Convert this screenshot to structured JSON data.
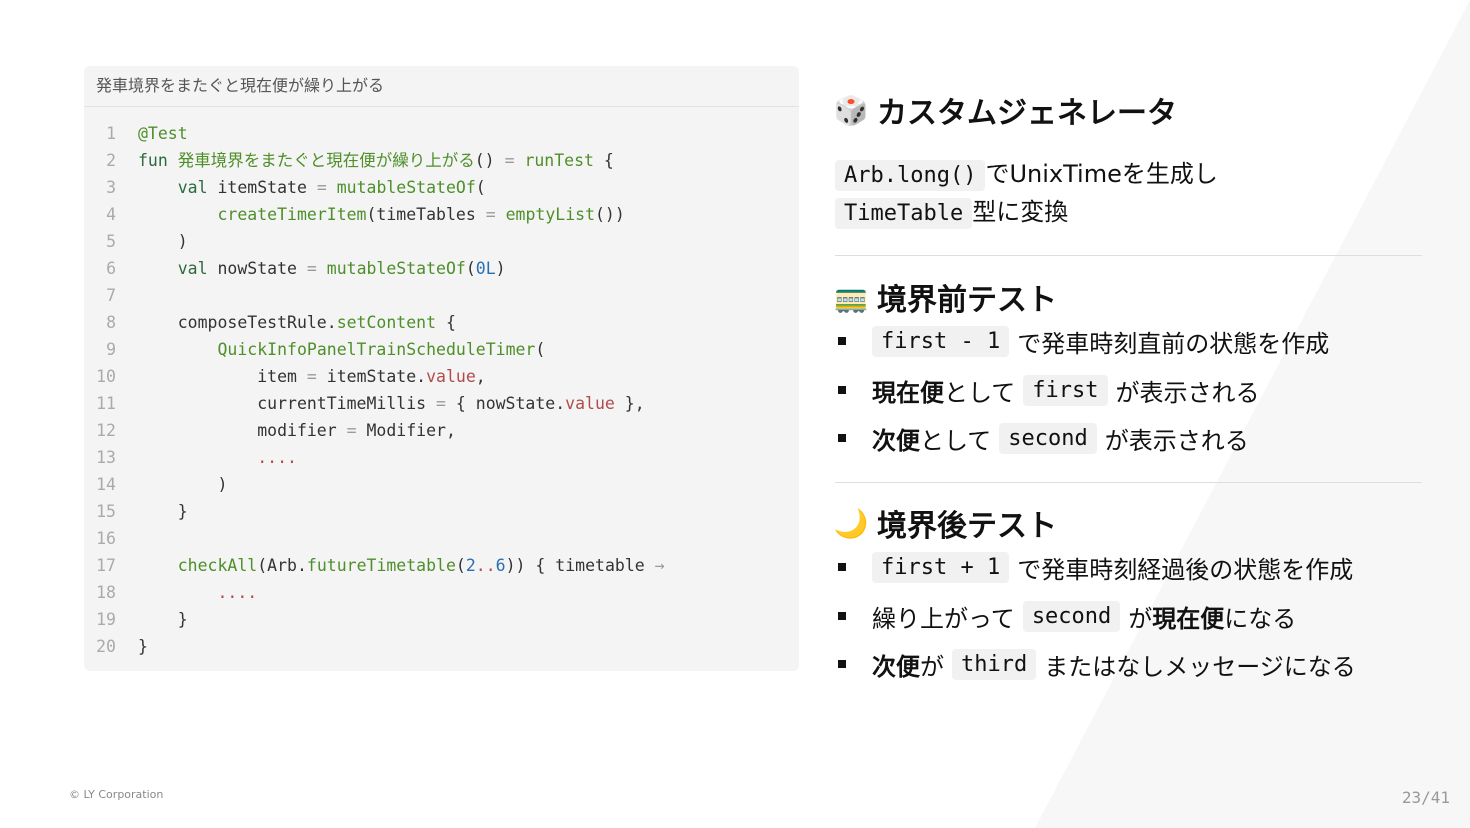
{
  "code_block": {
    "title": "発車境界をまたぐと現在便が繰り上がる",
    "lines": [
      {
        "num": "1",
        "tokens": [
          {
            "text": "@Test",
            "cls": "f"
          }
        ]
      },
      {
        "num": "2",
        "tokens": [
          {
            "text": "fun ",
            "cls": "k"
          },
          {
            "text": "発車境界をまたぐと現在便が繰り上がる",
            "cls": "f"
          },
          {
            "text": "() ",
            "cls": "t"
          },
          {
            "text": "=",
            "cls": "op"
          },
          {
            "text": " ",
            "cls": "t"
          },
          {
            "text": "runTest",
            "cls": "f"
          },
          {
            "text": " {",
            "cls": "t"
          }
        ]
      },
      {
        "num": "3",
        "tokens": [
          {
            "text": "    val ",
            "cls": "k"
          },
          {
            "text": "itemState ",
            "cls": "t"
          },
          {
            "text": "=",
            "cls": "op"
          },
          {
            "text": " ",
            "cls": "t"
          },
          {
            "text": "mutableStateOf",
            "cls": "f"
          },
          {
            "text": "(",
            "cls": "t"
          }
        ]
      },
      {
        "num": "4",
        "tokens": [
          {
            "text": "        ",
            "cls": "t"
          },
          {
            "text": "createTimerItem",
            "cls": "f"
          },
          {
            "text": "(timeTables ",
            "cls": "t"
          },
          {
            "text": "=",
            "cls": "op"
          },
          {
            "text": " ",
            "cls": "t"
          },
          {
            "text": "emptyList",
            "cls": "f"
          },
          {
            "text": "())",
            "cls": "t"
          }
        ]
      },
      {
        "num": "5",
        "tokens": [
          {
            "text": "    )",
            "cls": "t"
          }
        ]
      },
      {
        "num": "6",
        "tokens": [
          {
            "text": "    val ",
            "cls": "k"
          },
          {
            "text": "nowState ",
            "cls": "t"
          },
          {
            "text": "=",
            "cls": "op"
          },
          {
            "text": " ",
            "cls": "t"
          },
          {
            "text": "mutableStateOf",
            "cls": "f"
          },
          {
            "text": "(",
            "cls": "t"
          },
          {
            "text": "0L",
            "cls": "n"
          },
          {
            "text": ")",
            "cls": "t"
          }
        ]
      },
      {
        "num": "7",
        "tokens": []
      },
      {
        "num": "8",
        "tokens": [
          {
            "text": "    composeTestRule.",
            "cls": "t"
          },
          {
            "text": "setContent",
            "cls": "f"
          },
          {
            "text": " {",
            "cls": "t"
          }
        ]
      },
      {
        "num": "9",
        "tokens": [
          {
            "text": "        ",
            "cls": "t"
          },
          {
            "text": "QuickInfoPanelTrainScheduleTimer",
            "cls": "f"
          },
          {
            "text": "(",
            "cls": "t"
          }
        ]
      },
      {
        "num": "10",
        "tokens": [
          {
            "text": "            item ",
            "cls": "t"
          },
          {
            "text": "=",
            "cls": "op"
          },
          {
            "text": " itemState.",
            "cls": "t"
          },
          {
            "text": "value",
            "cls": "p"
          },
          {
            "text": ",",
            "cls": "t"
          }
        ]
      },
      {
        "num": "11",
        "tokens": [
          {
            "text": "            currentTimeMillis ",
            "cls": "t"
          },
          {
            "text": "=",
            "cls": "op"
          },
          {
            "text": " { nowState.",
            "cls": "t"
          },
          {
            "text": "value",
            "cls": "p"
          },
          {
            "text": " },",
            "cls": "t"
          }
        ]
      },
      {
        "num": "12",
        "tokens": [
          {
            "text": "            modifier ",
            "cls": "t"
          },
          {
            "text": "=",
            "cls": "op"
          },
          {
            "text": " Modifier,",
            "cls": "t"
          }
        ]
      },
      {
        "num": "13",
        "tokens": [
          {
            "text": "            ",
            "cls": "t"
          },
          {
            "text": "....",
            "cls": "p"
          }
        ]
      },
      {
        "num": "14",
        "tokens": [
          {
            "text": "        )",
            "cls": "t"
          }
        ]
      },
      {
        "num": "15",
        "tokens": [
          {
            "text": "    }",
            "cls": "t"
          }
        ]
      },
      {
        "num": "16",
        "tokens": []
      },
      {
        "num": "17",
        "tokens": [
          {
            "text": "    ",
            "cls": "t"
          },
          {
            "text": "checkAll",
            "cls": "f"
          },
          {
            "text": "(Arb.",
            "cls": "t"
          },
          {
            "text": "futureTimetable",
            "cls": "f"
          },
          {
            "text": "(",
            "cls": "t"
          },
          {
            "text": "2",
            "cls": "n"
          },
          {
            "text": "..",
            "cls": "p"
          },
          {
            "text": "6",
            "cls": "n"
          },
          {
            "text": ")) { timetable ",
            "cls": "t"
          },
          {
            "text": "→",
            "cls": "op"
          }
        ]
      },
      {
        "num": "18",
        "tokens": [
          {
            "text": "        ",
            "cls": "t"
          },
          {
            "text": "....",
            "cls": "p"
          }
        ]
      },
      {
        "num": "19",
        "tokens": [
          {
            "text": "    }",
            "cls": "t"
          }
        ]
      },
      {
        "num": "20",
        "tokens": [
          {
            "text": "}",
            "cls": "t"
          }
        ]
      }
    ]
  },
  "section_generator": {
    "emoji": "🎲",
    "emoji_icon": "dice-icon",
    "title": "カスタムジェネレータ",
    "line1_code": "Arb.long()",
    "line1_text": "でUnixTimeを生成し",
    "line2_code": "TimeTable",
    "line2_text": "型に変換"
  },
  "section_before": {
    "emoji": "🚃",
    "emoji_icon": "train-icon",
    "title": "境界前テスト",
    "b1_code": "first - 1",
    "b1_text": "で発車時刻直前の状態を作成",
    "b2_bold": "現在便",
    "b2_text1": "として",
    "b2_code": "first",
    "b2_text2": "が表示される",
    "b3_bold": "次便",
    "b3_text1": "として",
    "b3_code": "second",
    "b3_text2": "が表示される"
  },
  "section_after": {
    "emoji": "🌙",
    "emoji_icon": "moon-icon",
    "title": "境界後テスト",
    "b1_code": "first + 1",
    "b1_text": "で発車時刻経過後の状態を作成",
    "b2_text1": "繰り上がって",
    "b2_code": "second",
    "b2_text2": "が",
    "b2_bold": "現在便",
    "b2_text3": "になる",
    "b3_bold": "次便",
    "b3_text1": "が",
    "b3_code": "third",
    "b3_text2": "またはなしメッセージになる"
  },
  "footer": {
    "copyright": "© LY Corporation",
    "page": "23/41"
  }
}
